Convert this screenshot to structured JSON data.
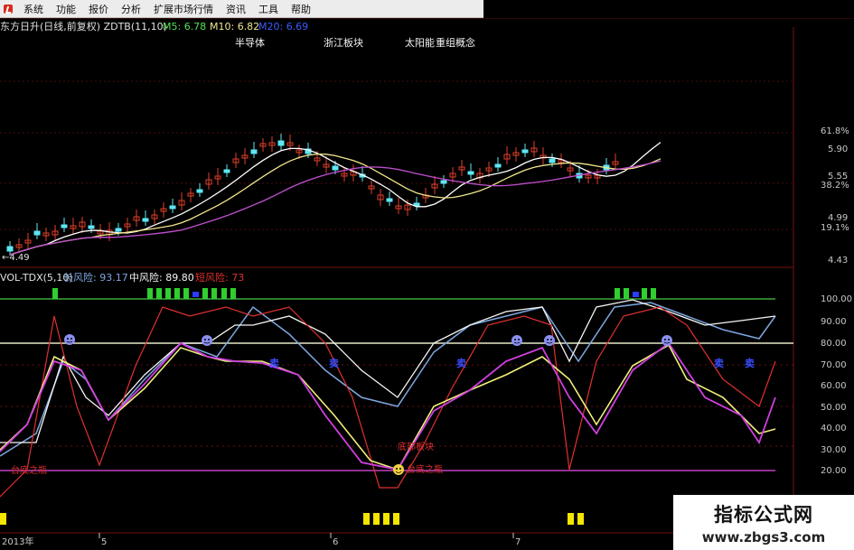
{
  "menu": {
    "items": [
      "系统",
      "功能",
      "报价",
      "分析",
      "扩展市场行情",
      "资讯",
      "工具",
      "帮助"
    ]
  },
  "price_panel": {
    "title": "东方日升(日线,前复权) ZDTB(11,10)",
    "m5": "M5: 6.78",
    "m10": "M10: 6.82",
    "m20": "M20: 6.69",
    "concepts": [
      "半导体",
      "浙江板块",
      "太阳能",
      "重组概念"
    ],
    "low_label": "←4.49",
    "right_axis": [
      "61.8%",
      "5.90",
      "5.55",
      "38.2%",
      "4.99",
      "19.1%",
      "4.43"
    ]
  },
  "indicator_panel": {
    "title": "VOL-TDX(5,10)",
    "long_risk": "长风险: 93.17",
    "mid_risk": "中风险: 89.80",
    "short_risk": "短风险: 73",
    "right_axis": [
      "100.00",
      "90.00",
      "80.00",
      "70.00",
      "60.00",
      "50.00",
      "40.00",
      "30.00",
      "20.00"
    ],
    "bottom_labels": [
      "台底之瓶",
      "底部板块",
      "台底之瓶"
    ],
    "sell_markers": [
      "卖",
      "卖",
      "卖",
      "卖",
      "卖"
    ]
  },
  "time_axis": {
    "labels": [
      "2013年",
      "5",
      "6",
      "7"
    ]
  },
  "watermark": {
    "title": "指标公式网",
    "url": "www.zbgs3.com"
  },
  "colors": {
    "background": "#000000",
    "up_candle": "#e0402a",
    "down_candle": "#5ee7f5",
    "ma5": "#ffffff",
    "ma10": "#f0e68c",
    "ma20": "#c050d0",
    "long_risk": "#7fa7e0",
    "mid_risk": "#f5f5f5",
    "short_risk": "#e03030",
    "indicator_yellow": "#f0f07a",
    "indicator_magenta": "#d040e0",
    "signal_green": "#3ccf3c",
    "signal_yellow": "#f5e600",
    "grid_red": "#7a1010"
  },
  "chart_data": {
    "type": "line",
    "title": "东方日升(日线,前复权) ZDTB(11,10)",
    "series": [
      {
        "name": "M5",
        "values": [
          6.78
        ]
      },
      {
        "name": "M10",
        "values": [
          6.82
        ]
      },
      {
        "name": "M20",
        "values": [
          6.69
        ]
      }
    ],
    "price_range": [
      4.43,
      6.2
    ],
    "indicator_range": [
      20,
      100
    ]
  }
}
